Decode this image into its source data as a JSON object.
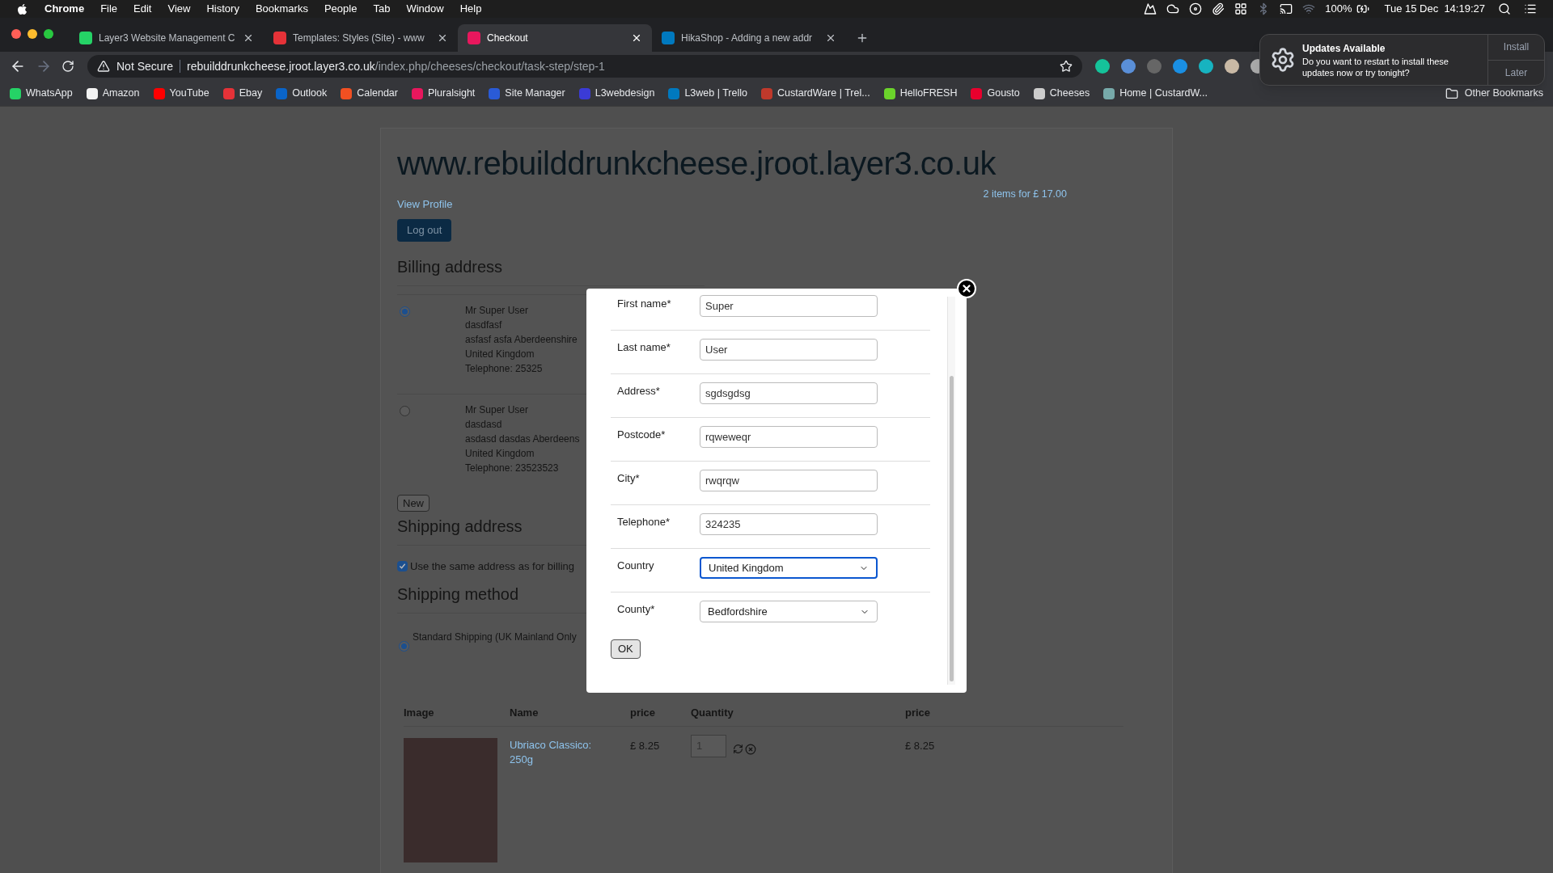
{
  "menu_bar": {
    "app": "Chrome",
    "menus": [
      "File",
      "Edit",
      "View",
      "History",
      "Bookmarks",
      "People",
      "Tab",
      "Window",
      "Help"
    ],
    "battery": "100%",
    "clock": "Tue 15 Dec  14:19:27"
  },
  "tabs": [
    {
      "title": "Layer3 Website Management C",
      "selected": false
    },
    {
      "title": "Templates: Styles (Site) - www",
      "selected": false
    },
    {
      "title": "Checkout",
      "selected": true
    },
    {
      "title": "HikaShop - Adding a new addr",
      "selected": false
    }
  ],
  "address_bar": {
    "security": "Not Secure",
    "host": "rebuilddrunkcheese.jroot.layer3.co.uk",
    "path": "/index.php/cheeses/checkout/task-step/step-1"
  },
  "bookmarks": [
    "WhatsApp",
    "Amazon",
    "YouTube",
    "Ebay",
    "Outlook",
    "Calendar",
    "Pluralsight",
    "Site Manager",
    "L3webdesign",
    "L3web | Trello",
    "CustardWare | Trel...",
    "HelloFRESH",
    "Gousto",
    "Cheeses",
    "Home | CustardW..."
  ],
  "other_bookmarks": "Other Bookmarks",
  "notification": {
    "title": "Updates Available",
    "message": "Do you want to restart to install these updates now or try tonight?",
    "buttons": [
      "Install",
      "Later"
    ]
  },
  "page": {
    "site_title": "www.rebuilddrunkcheese.jroot.layer3.co.uk",
    "view_profile": "View Profile",
    "cart_summary": "2 items for £ 17.00",
    "logout": "Log out",
    "billing": {
      "heading": "Billing address",
      "addresses": [
        {
          "selected": true,
          "lines": [
            "Mr Super User",
            "dasdfasf",
            "asfasf asfa Aberdeenshire",
            "United Kingdom",
            "Telephone: 25325"
          ]
        },
        {
          "selected": false,
          "lines": [
            "Mr Super User",
            "dasdasd",
            "asdasd dasdas Aberdeens",
            "United Kingdom",
            "Telephone: 23523523"
          ]
        }
      ],
      "new_button": "New"
    },
    "shipping_address": {
      "heading": "Shipping address",
      "same_as_billing": {
        "label": "Use the same address as for billing",
        "checked": true
      }
    },
    "shipping_method": {
      "heading": "Shipping method",
      "options": [
        {
          "label": "Standard Shipping (UK Mainland Only",
          "selected": true
        }
      ]
    },
    "cart": {
      "columns": [
        "Image",
        "Name",
        "price",
        "Quantity",
        "price"
      ],
      "rows": [
        {
          "name": "Ubriaco Classico: 250g",
          "price": "£ 8.25",
          "quantity": "1",
          "total": "£ 8.25"
        }
      ]
    }
  },
  "modal": {
    "fields": [
      {
        "kind": "text",
        "label": "First name*",
        "value": "Super"
      },
      {
        "kind": "text",
        "label": "Last name*",
        "value": "User"
      },
      {
        "kind": "text",
        "label": "Address*",
        "value": "sgdsgdsg"
      },
      {
        "kind": "text",
        "label": "Postcode*",
        "value": "rqweweqr"
      },
      {
        "kind": "text",
        "label": "City*",
        "value": "rwqrqw"
      },
      {
        "kind": "text",
        "label": "Telephone*",
        "value": "324235"
      },
      {
        "kind": "select",
        "label": "Country",
        "value": "United Kingdom",
        "focused": true
      },
      {
        "kind": "select",
        "label": "County*",
        "value": "Bedfordshire",
        "focused": false
      }
    ],
    "ok": "OK"
  }
}
